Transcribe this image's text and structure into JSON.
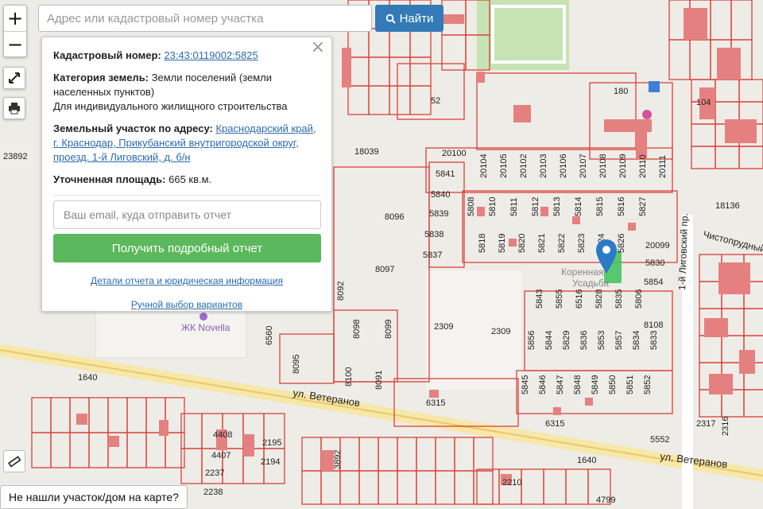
{
  "search": {
    "placeholder": "Адрес или кадастровый номер участка",
    "button_label": "Найти"
  },
  "zoom": {
    "in_label": "+",
    "out_label": "−"
  },
  "panel": {
    "cadastral_label": "Кадастровый номер:",
    "cadastral_value": "23:43:0119002:5825",
    "category_label": "Категория земель:",
    "category_value": "Земли поселений (земли населенных пунктов)",
    "usage_value": "Для индивидуального жилищного строительства",
    "address_label": "Земельный участок по адресу:",
    "address_value": "Краснодарский край, г. Краснодар, Прикубанский внутригородской округ, проезд. 1-й Лиговский, д. б/н",
    "area_label": "Уточненная площадь:",
    "area_value": "665 кв.м.",
    "email_placeholder": "Ваш email, куда отправить отчет",
    "get_report_label": "Получить подробный отчет",
    "details_link": "Детали отчета и юридическая информация",
    "manual_link": "Ручной выбор вариантов"
  },
  "not_found_label": "Не нашли участок/дом на карте?",
  "map": {
    "street_veteranov": "ул. Ветеранов",
    "street_ligovsky": "1-й Лиговский пр.",
    "street_chistoprudny": "Чистопрудный",
    "poi_novella": "ЖК Novella",
    "poi_korennaya": "Коренная Усадьба",
    "label_1640": "1640",
    "label_23892": "23892",
    "label_18039": "18039",
    "label_18136": "18136",
    "label_2309": "2309",
    "label_6315": "6315",
    "label_5552": "5552",
    "label_8096": "8096",
    "label_8097": "8097",
    "label_8098": "8098",
    "label_8099": "8099",
    "label_8100": "8100",
    "label_8091": "8091",
    "label_8092": "8092",
    "label_8095": "8095",
    "label_6560": "6560",
    "label_8108": "8108",
    "label_20100": "20100",
    "label_20099": "20099",
    "label_5837": "5837",
    "label_5838": "5838",
    "label_5839": "5839",
    "label_5840": "5840",
    "label_5841": "5841",
    "label_5830": "5830",
    "label_5854": "5854",
    "label_2317": "2317",
    "label_2316": "2316",
    "label_4408": "4408",
    "label_4407": "4407",
    "label_2237": "2237",
    "label_2238": "2238",
    "label_2195": "2195",
    "label_2194": "2194",
    "label_2210": "2210",
    "label_4799": "4799",
    "label_3892": "3892",
    "label_180": "180",
    "label_104": "104",
    "label_52": "52",
    "row_5808": [
      "5808",
      "5810",
      "5811",
      "5812",
      "5813",
      "5814",
      "5815",
      "5816",
      "5827"
    ],
    "row_5818": [
      "5818",
      "5819",
      "5820",
      "5821",
      "5822",
      "5823",
      "5824",
      "5826"
    ],
    "row_5843": [
      "5843",
      "5855",
      "6516",
      "5828",
      "5835",
      "5806"
    ],
    "row_5856": [
      "5856",
      "5844",
      "5829",
      "5836",
      "5853",
      "5857",
      "5834",
      "5833"
    ],
    "row_5845": [
      "5845",
      "5846",
      "5847",
      "5848",
      "5849",
      "5850",
      "5851",
      "5852"
    ],
    "row_20104": [
      "20104",
      "20105",
      "20102",
      "20103",
      "20106",
      "20107",
      "20108",
      "20109",
      "20110",
      "20111"
    ]
  }
}
